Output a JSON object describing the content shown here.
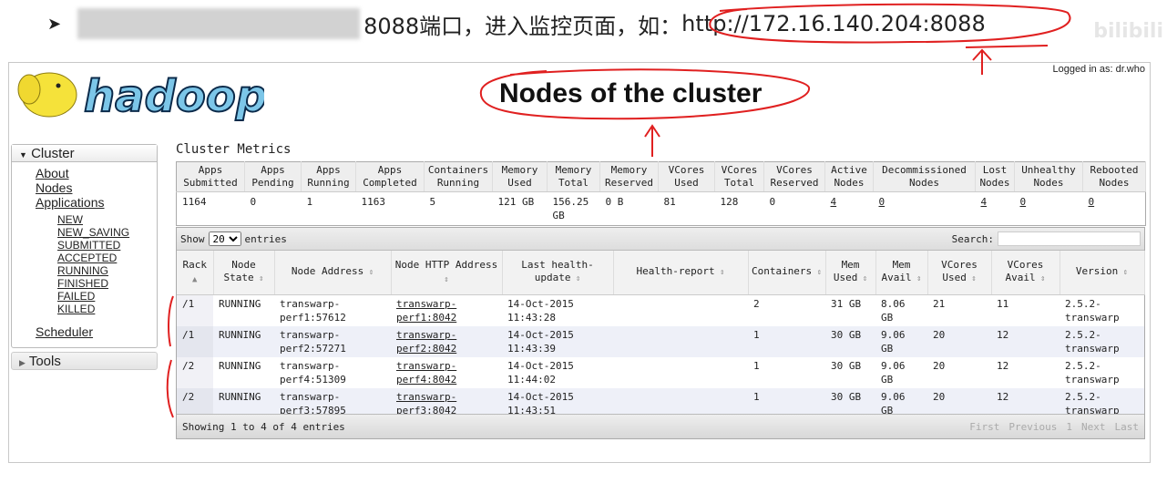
{
  "slide": {
    "bullet": "➤",
    "text": "8088端口，进入监控页面，如：",
    "url": "http://172.16.140.204:8088",
    "watermark": "bilibili"
  },
  "header": {
    "logo": "hadoop",
    "title": "Nodes of the cluster",
    "logged_in": "Logged in as: dr.who"
  },
  "sidebar": {
    "cluster": "Cluster",
    "items": [
      "About",
      "Nodes",
      "Applications"
    ],
    "app_states": [
      "NEW",
      "NEW_SAVING",
      "SUBMITTED",
      "ACCEPTED",
      "RUNNING",
      "FINISHED",
      "FAILED",
      "KILLED"
    ],
    "scheduler": "Scheduler",
    "tools": "Tools"
  },
  "metrics": {
    "label": "Cluster Metrics",
    "headers": [
      "Apps Submitted",
      "Apps Pending",
      "Apps Running",
      "Apps Completed",
      "Containers Running",
      "Memory Used",
      "Memory Total",
      "Memory Reserved",
      "VCores Used",
      "VCores Total",
      "VCores Reserved",
      "Active Nodes",
      "Decommissioned Nodes",
      "Lost Nodes",
      "Unhealthy Nodes",
      "Rebooted Nodes"
    ],
    "values": [
      "1164",
      "0",
      "1",
      "1163",
      "5",
      "121 GB",
      "156.25 GB",
      "0 B",
      "81",
      "128",
      "0",
      "4",
      "0",
      "4",
      "0",
      "0"
    ]
  },
  "nodes": {
    "show_label": "Show",
    "show_value": "20",
    "entries_label": "entries",
    "search_label": "Search:",
    "search_value": "",
    "headers": [
      "Rack",
      "Node State",
      "Node Address",
      "Node HTTP Address",
      "Last health-update",
      "Health-report",
      "Containers",
      "Mem Used",
      "Mem Avail",
      "VCores Used",
      "VCores Avail",
      "Version"
    ],
    "rows": [
      [
        "/1",
        "RUNNING",
        "transwarp-perf1:57612",
        "transwarp-perf1:8042",
        "14-Oct-2015 11:43:28",
        "",
        "2",
        "31 GB",
        "8.06 GB",
        "21",
        "11",
        "2.5.2-transwarp"
      ],
      [
        "/1",
        "RUNNING",
        "transwarp-perf2:57271",
        "transwarp-perf2:8042",
        "14-Oct-2015 11:43:39",
        "",
        "1",
        "30 GB",
        "9.06 GB",
        "20",
        "12",
        "2.5.2-transwarp"
      ],
      [
        "/2",
        "RUNNING",
        "transwarp-perf4:51309",
        "transwarp-perf4:8042",
        "14-Oct-2015 11:44:02",
        "",
        "1",
        "30 GB",
        "9.06 GB",
        "20",
        "12",
        "2.5.2-transwarp"
      ],
      [
        "/2",
        "RUNNING",
        "transwarp-perf3:57895",
        "transwarp-perf3:8042",
        "14-Oct-2015 11:43:51",
        "",
        "1",
        "30 GB",
        "9.06 GB",
        "20",
        "12",
        "2.5.2-transwarp"
      ]
    ],
    "footer": "Showing 1 to 4 of 4 entries",
    "pager": [
      "First",
      "Previous",
      "1",
      "Next",
      "Last"
    ]
  },
  "colors": {
    "annotation": "#e02020",
    "logo_elephant": "#f5e23a",
    "logo_text": "#7cc6e8"
  }
}
